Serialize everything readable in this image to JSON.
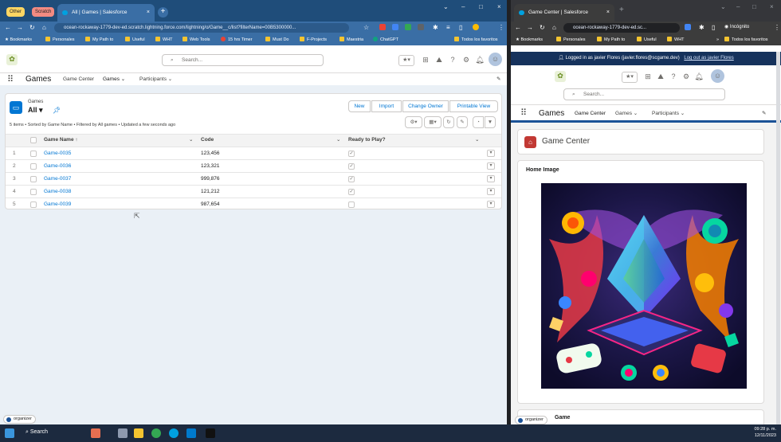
{
  "left": {
    "tab_groups": [
      "Other",
      "Scratch"
    ],
    "tab_title": "All | Games | Salesforce",
    "url": "ocean-rockaway-1779-dev-ed.scratch.lightning.force.com/lightning/o/Game__c/list?filterName=00B5300000...",
    "bookmarks": [
      "Bookmarks",
      "Personales",
      "My Path to",
      "Useful",
      "WHT",
      "Web Tools",
      "15 hrs Timer",
      "Must Do",
      "F-Projects",
      "Maestria",
      "ChatGPT",
      "Todos los favoritos"
    ],
    "search_placeholder": "Search...",
    "app_name": "Games",
    "nav": [
      "Game Center",
      "Games",
      "Participants"
    ],
    "object_label": "Games",
    "list_name": "All",
    "buttons": [
      "New",
      "Import",
      "Change Owner",
      "Printable View"
    ],
    "status": "5 items • Sorted by Game Name • Filtered by All games • Updated a few seconds ago",
    "columns": [
      "Game Name ↑",
      "Code",
      "Ready to Play?"
    ],
    "rows": [
      {
        "n": "1",
        "name": "Game-0035",
        "code": "123,456",
        "ready": "✓"
      },
      {
        "n": "2",
        "name": "Game-0036",
        "code": "123,321",
        "ready": "✓"
      },
      {
        "n": "3",
        "name": "Game-0037",
        "code": "999,876",
        "ready": "✓"
      },
      {
        "n": "4",
        "name": "Game-0038",
        "code": "121,212",
        "ready": "✓"
      },
      {
        "n": "5",
        "name": "Game-0039",
        "code": "987,654",
        "ready": ""
      }
    ],
    "organizer": "organizer"
  },
  "right": {
    "tab_title": "Game Center | Salesforce",
    "url": "ocean-rockaway-1779-dev-ed.sc...",
    "incognito": "Incógnito",
    "bookmarks": [
      "Bookmarks",
      "Personales",
      "My Path to",
      "Useful",
      "WHT",
      "Todos los favoritos"
    ],
    "login_text": "Logged in as javier Flores (javier.flores@scgame.dev)",
    "logout": "Log out as javier Flores",
    "search_placeholder": "Search...",
    "app_name": "Games",
    "nav": [
      "Game Center",
      "Games",
      "Participants"
    ],
    "page_title": "Game Center",
    "card_title": "Home Image",
    "card2_title": "Game",
    "organizer": "organizer"
  },
  "taskbar": {
    "search": "Search",
    "time": "09:28 p. m.",
    "date": "12/11/2023"
  }
}
